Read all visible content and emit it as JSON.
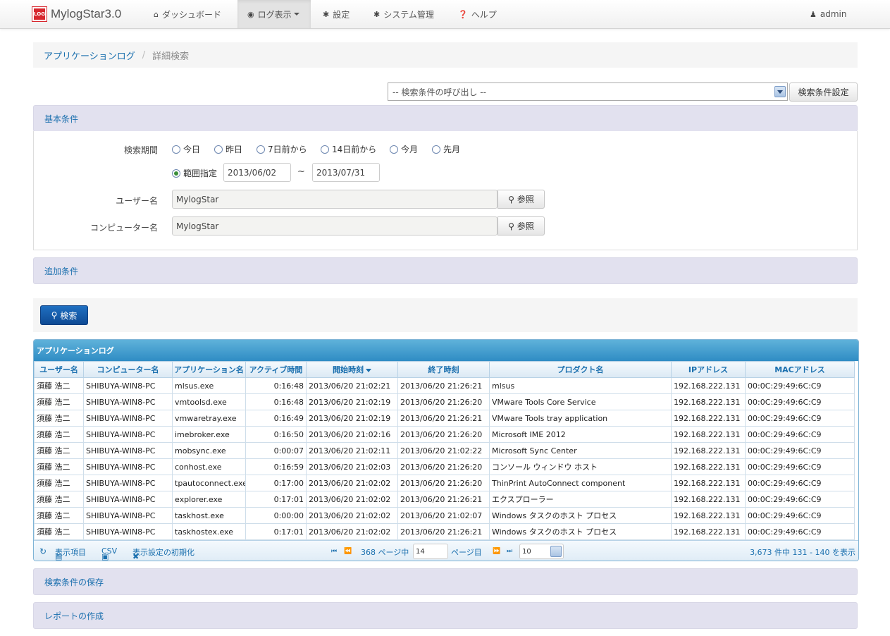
{
  "app": {
    "logo_text": "LOG",
    "name": "MylogStar3.0"
  },
  "nav": {
    "dashboard": "ダッシュボード",
    "log_view": "ログ表示",
    "settings": "設定",
    "system": "システム管理",
    "help": "ヘルプ",
    "user": "admin"
  },
  "breadcrumb": {
    "parent": "アプリケーションログ",
    "separator": "/",
    "current": "詳細検索"
  },
  "saved_conditions": {
    "selected": "-- 検索条件の呼び出し --",
    "button": "検索条件設定"
  },
  "basic": {
    "title": "基本条件",
    "period_label": "検索期間",
    "period_options": [
      "今日",
      "昨日",
      "7日前から",
      "14日前から",
      "今月",
      "先月"
    ],
    "range_label": "範囲指定",
    "range_selected": true,
    "date_from": "2013/06/02",
    "date_sep": "~",
    "date_to": "2013/07/31",
    "user_label": "ユーザー名",
    "user_value": "MylogStar",
    "computer_label": "コンピューター名",
    "computer_value": "MylogStar",
    "browse_button": "参照"
  },
  "additional": {
    "title": "追加条件"
  },
  "search_button": "検索",
  "grid": {
    "caption": "アプリケーションログ",
    "columns": [
      "ユーザー名",
      "コンピューター名",
      "アプリケーション名",
      "アクティブ時間",
      "開始時刻",
      "終了時刻",
      "プロダクト名",
      "IPアドレス",
      "MACアドレス"
    ],
    "rows": [
      [
        "須藤 浩二",
        "SHIBUYA-WIN8-PC",
        "mlsus.exe",
        "0:16:48",
        "2013/06/20 21:02:21",
        "2013/06/20 21:26:21",
        "mlsus",
        "192.168.222.131",
        "00:0C:29:49:6C:C9"
      ],
      [
        "須藤 浩二",
        "SHIBUYA-WIN8-PC",
        "vmtoolsd.exe",
        "0:16:48",
        "2013/06/20 21:02:19",
        "2013/06/20 21:26:20",
        "VMware Tools Core Service",
        "192.168.222.131",
        "00:0C:29:49:6C:C9"
      ],
      [
        "須藤 浩二",
        "SHIBUYA-WIN8-PC",
        "vmwaretray.exe",
        "0:16:49",
        "2013/06/20 21:02:19",
        "2013/06/20 21:26:21",
        "VMware Tools tray application",
        "192.168.222.131",
        "00:0C:29:49:6C:C9"
      ],
      [
        "須藤 浩二",
        "SHIBUYA-WIN8-PC",
        "imebroker.exe",
        "0:16:50",
        "2013/06/20 21:02:16",
        "2013/06/20 21:26:20",
        "Microsoft IME 2012",
        "192.168.222.131",
        "00:0C:29:49:6C:C9"
      ],
      [
        "須藤 浩二",
        "SHIBUYA-WIN8-PC",
        "mobsync.exe",
        "0:00:07",
        "2013/06/20 21:02:11",
        "2013/06/20 21:02:22",
        "Microsoft Sync Center",
        "192.168.222.131",
        "00:0C:29:49:6C:C9"
      ],
      [
        "須藤 浩二",
        "SHIBUYA-WIN8-PC",
        "conhost.exe",
        "0:16:59",
        "2013/06/20 21:02:03",
        "2013/06/20 21:26:20",
        "コンソール ウィンドウ ホスト",
        "192.168.222.131",
        "00:0C:29:49:6C:C9"
      ],
      [
        "須藤 浩二",
        "SHIBUYA-WIN8-PC",
        "tpautoconnect.exe",
        "0:17:00",
        "2013/06/20 21:02:02",
        "2013/06/20 21:26:20",
        "ThinPrint AutoConnect component",
        "192.168.222.131",
        "00:0C:29:49:6C:C9"
      ],
      [
        "須藤 浩二",
        "SHIBUYA-WIN8-PC",
        "explorer.exe",
        "0:17:01",
        "2013/06/20 21:02:02",
        "2013/06/20 21:26:21",
        "エクスプローラー",
        "192.168.222.131",
        "00:0C:29:49:6C:C9"
      ],
      [
        "須藤 浩二",
        "SHIBUYA-WIN8-PC",
        "taskhost.exe",
        "0:00:00",
        "2013/06/20 21:02:02",
        "2013/06/20 21:02:07",
        "Windows タスクのホスト プロセス",
        "192.168.222.131",
        "00:0C:29:49:6C:C9"
      ],
      [
        "須藤 浩二",
        "SHIBUYA-WIN8-PC",
        "taskhostex.exe",
        "0:17:01",
        "2013/06/20 21:02:02",
        "2013/06/20 21:26:21",
        "Windows タスクのホスト プロセス",
        "192.168.222.131",
        "00:0C:29:49:6C:C9"
      ]
    ],
    "sort_column": "開始時刻"
  },
  "pager": {
    "columns_btn": "表示項目",
    "csv_btn": "CSV",
    "reset_btn": "表示設定の初期化",
    "page_total": "368 ページ中",
    "page_current": "14",
    "page_suffix": "ページ目",
    "page_size": "10",
    "summary": "3,673 件中 131 - 140 を表示"
  },
  "save_section": {
    "title": "検索条件の保存"
  },
  "report_section": {
    "title": "レポートの作成"
  }
}
